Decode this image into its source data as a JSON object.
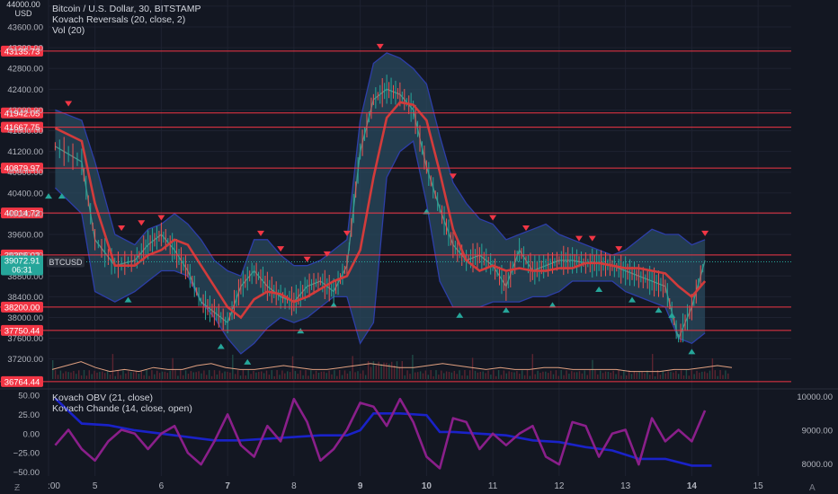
{
  "header": {
    "symbol_line": "Bitcoin / U.S. Dollar, 30, BITSTAMP",
    "indicator_line": "Kovach Reversals (20, close, 2)",
    "volume_line": "Vol (20)",
    "axis_top_label": "44000.00",
    "axis_currency": "USD"
  },
  "lower_pane": {
    "obv_line": "Kovach OBV (21, close)",
    "chande_line": "Kovach Chande (14, close, open)"
  },
  "colors": {
    "background": "#131722",
    "hline": "#f23645",
    "price_tag": "#f23645",
    "current_tag": "#26a69a",
    "basis": "#d23b3b",
    "band_fill": "#2a4a5e",
    "band_edge": "#2d3ea8",
    "obv": "#1a22c8",
    "chande": "#8a1f8a",
    "up_marker": "#26a69a",
    "down_marker": "#f23645"
  },
  "current_price": {
    "value": "39072.91",
    "countdown": "06:31",
    "ticker": "BTCUSD"
  },
  "chart_data": [
    {
      "type": "line",
      "title": "Bitcoin / U.S. Dollar, 30, BITSTAMP",
      "y_ticks": [
        37200,
        37600,
        38000,
        38400,
        38800,
        39200,
        39600,
        40000,
        40400,
        40800,
        41200,
        41600,
        42000,
        42400,
        42800,
        43200,
        43600,
        44000
      ],
      "y_tick_labels": [
        "37200.00",
        "37600.00",
        "38000.00",
        "38400.00",
        "38800.00",
        "39200.00",
        "39600.00",
        "40000.00",
        "40400.00",
        "40800.00",
        "41200.00",
        "41600.00",
        "42000.00",
        "42400.00",
        "42800.00",
        "43200.00",
        "43600.00",
        "44000.00"
      ],
      "ylim": [
        36640,
        44120
      ],
      "x_tick_labels": [
        ":00",
        "5",
        "6",
        "7",
        "8",
        "9",
        "10",
        "11",
        "12",
        "13",
        "14",
        "15"
      ],
      "bold_x_ticks": [
        "7",
        "9",
        "10",
        "14"
      ],
      "price_levels": [
        {
          "value": 43135.73,
          "label": "43135.73"
        },
        {
          "value": 41942.05,
          "label": "41942.05"
        },
        {
          "value": 41667.75,
          "label": "41667.75"
        },
        {
          "value": 40879.97,
          "label": "40879.97"
        },
        {
          "value": 40014.72,
          "label": "40014.72"
        },
        {
          "value": 39205.02,
          "label": "39205.02"
        },
        {
          "value": 38200.0,
          "label": "38200.00"
        },
        {
          "value": 37750.44,
          "label": "37750.44"
        },
        {
          "value": 36764.44,
          "label": "36764.44"
        }
      ],
      "series": [
        {
          "x": [
            4.4,
            4.8,
            5.0,
            5.3,
            5.6,
            5.8,
            6.0,
            6.2,
            6.4,
            6.6,
            6.8,
            7.0,
            7.2,
            7.4,
            7.6,
            7.8,
            8.0,
            8.2,
            8.4,
            8.6,
            8.8,
            9.0,
            9.2,
            9.4,
            9.6,
            9.8,
            10.0,
            10.2,
            10.4,
            10.6,
            10.8,
            11.0,
            11.2,
            11.4,
            11.6,
            11.8,
            12.0,
            12.2,
            12.4,
            12.6,
            12.8,
            13.0,
            13.2,
            13.4,
            13.6,
            13.8,
            14.0,
            14.2
          ],
          "close": [
            41300,
            41000,
            39500,
            39000,
            39100,
            39400,
            39600,
            39300,
            38900,
            38300,
            38100,
            37900,
            38600,
            38900,
            38600,
            38400,
            38300,
            38600,
            38700,
            38500,
            39000,
            41200,
            42200,
            42400,
            42300,
            42000,
            40900,
            40100,
            39400,
            39100,
            39200,
            39000,
            38600,
            39300,
            38900,
            39000,
            39100,
            39100,
            39050,
            39050,
            39000,
            38900,
            38800,
            38700,
            38600,
            37600,
            38200,
            39100
          ],
          "basis": [
            41650,
            41400,
            40200,
            39000,
            39000,
            39200,
            39300,
            39500,
            39400,
            39000,
            38600,
            38200,
            38000,
            38350,
            38500,
            38450,
            38300,
            38400,
            38550,
            38700,
            38800,
            39300,
            40700,
            41850,
            42150,
            42100,
            41800,
            40800,
            39700,
            39100,
            38900,
            39000,
            38900,
            38950,
            38900,
            38900,
            38950,
            38950,
            39050,
            39050,
            39000,
            38950,
            38950,
            38900,
            38850,
            38600,
            38400,
            38700
          ],
          "upper": [
            42000,
            41800,
            41000,
            39600,
            39400,
            39700,
            39800,
            40000,
            39800,
            39500,
            39100,
            38900,
            38800,
            39500,
            39500,
            39200,
            39000,
            39000,
            39100,
            39300,
            39500,
            41800,
            42900,
            43100,
            43000,
            42800,
            42500,
            41500,
            40600,
            40200,
            39900,
            39800,
            39500,
            39600,
            39700,
            39800,
            39600,
            39500,
            39400,
            39300,
            39200,
            39300,
            39500,
            39700,
            39600,
            39600,
            39400,
            39500
          ],
          "lower": [
            40500,
            40000,
            38500,
            38300,
            38500,
            38700,
            38900,
            38900,
            38800,
            38300,
            38000,
            37600,
            37300,
            37500,
            37800,
            38000,
            37900,
            38000,
            38200,
            38400,
            38400,
            37500,
            37900,
            40700,
            41200,
            41400,
            40200,
            38700,
            38200,
            38200,
            38200,
            38300,
            38300,
            38300,
            38400,
            38400,
            38500,
            38700,
            38700,
            38700,
            38700,
            38500,
            38400,
            38300,
            38200,
            37600,
            37500,
            37700
          ]
        }
      ],
      "down_markers_x": [
        4.6,
        5.4,
        5.7,
        6.0,
        7.5,
        7.8,
        8.2,
        8.5,
        8.8,
        9.3,
        10.4,
        11.0,
        11.5,
        12.3,
        12.5,
        12.9,
        14.2
      ],
      "up_markers_x": [
        4.3,
        4.5,
        5.5,
        6.9,
        7.3,
        8.1,
        8.6,
        10.0,
        10.5,
        11.2,
        11.9,
        12.6,
        13.1,
        13.5,
        13.7,
        14.0
      ],
      "volume_line": [
        0.3,
        0.5,
        0.7,
        0.4,
        0.2,
        0.3,
        0.2,
        0.4,
        0.3,
        0.3,
        0.5,
        0.6,
        0.4,
        0.3,
        0.3,
        0.4,
        0.5,
        0.4,
        0.3,
        0.3,
        0.4,
        0.5,
        0.6,
        0.5,
        0.4,
        0.4,
        0.5,
        0.6,
        0.5,
        0.4,
        0.3,
        0.4,
        0.3,
        0.3,
        0.4,
        0.4,
        0.3,
        0.3,
        0.3,
        0.3,
        0.2,
        0.2,
        0.2,
        0.3,
        0.3,
        0.4,
        0.5,
        0.4
      ]
    },
    {
      "type": "line",
      "title": "Kovach OBV / Kovach Chande",
      "left_y_ticks": [
        50,
        25,
        0,
        -25,
        -50
      ],
      "left_y_tick_labels": [
        "50.00",
        "25.00",
        "0.00",
        "−25.00",
        "−50.00"
      ],
      "left_ylim": [
        -55,
        58
      ],
      "right_y_ticks": [
        10000,
        9000,
        8000
      ],
      "right_y_tick_labels": [
        "10000.00",
        "9000.00",
        "8000.00"
      ],
      "right_ylim": [
        7640,
        10230
      ],
      "series": [
        {
          "name": "Kovach OBV (21, close)",
          "x": [
            4.4,
            4.8,
            5.2,
            5.6,
            6.0,
            6.4,
            6.8,
            7.2,
            7.6,
            8.0,
            8.4,
            8.8,
            9.0,
            9.2,
            9.6,
            10.0,
            10.2,
            10.4,
            10.8,
            11.2,
            11.6,
            12.0,
            12.4,
            12.8,
            13.2,
            13.6,
            14.0,
            14.3
          ],
          "values": [
            9950,
            9200,
            9150,
            9000,
            8900,
            8800,
            8700,
            8700,
            8750,
            8800,
            8850,
            8850,
            9000,
            9500,
            9500,
            9450,
            8950,
            8950,
            8900,
            8850,
            8700,
            8650,
            8500,
            8400,
            8150,
            8150,
            7950,
            7950
          ]
        },
        {
          "name": "Kovach Chande (14, close, open)",
          "x": [
            4.4,
            4.6,
            4.8,
            5.0,
            5.2,
            5.4,
            5.6,
            5.8,
            6.0,
            6.2,
            6.4,
            6.6,
            6.8,
            7.0,
            7.2,
            7.4,
            7.6,
            7.8,
            8.0,
            8.2,
            8.4,
            8.6,
            8.8,
            9.0,
            9.2,
            9.4,
            9.6,
            9.8,
            10.0,
            10.2,
            10.4,
            10.6,
            10.8,
            11.0,
            11.2,
            11.4,
            11.6,
            11.8,
            12.0,
            12.2,
            12.4,
            12.6,
            12.8,
            13.0,
            13.2,
            13.4,
            13.6,
            13.8,
            14.0,
            14.2
          ],
          "values": [
            -15,
            5,
            -20,
            -35,
            -10,
            5,
            0,
            -20,
            0,
            10,
            -25,
            -40,
            -10,
            25,
            -15,
            -30,
            10,
            -10,
            45,
            15,
            -35,
            -20,
            5,
            40,
            35,
            10,
            45,
            15,
            -30,
            -45,
            20,
            15,
            -20,
            0,
            -15,
            0,
            10,
            -30,
            -40,
            15,
            10,
            -30,
            0,
            5,
            -40,
            20,
            -10,
            5,
            -10,
            30
          ]
        }
      ]
    }
  ]
}
